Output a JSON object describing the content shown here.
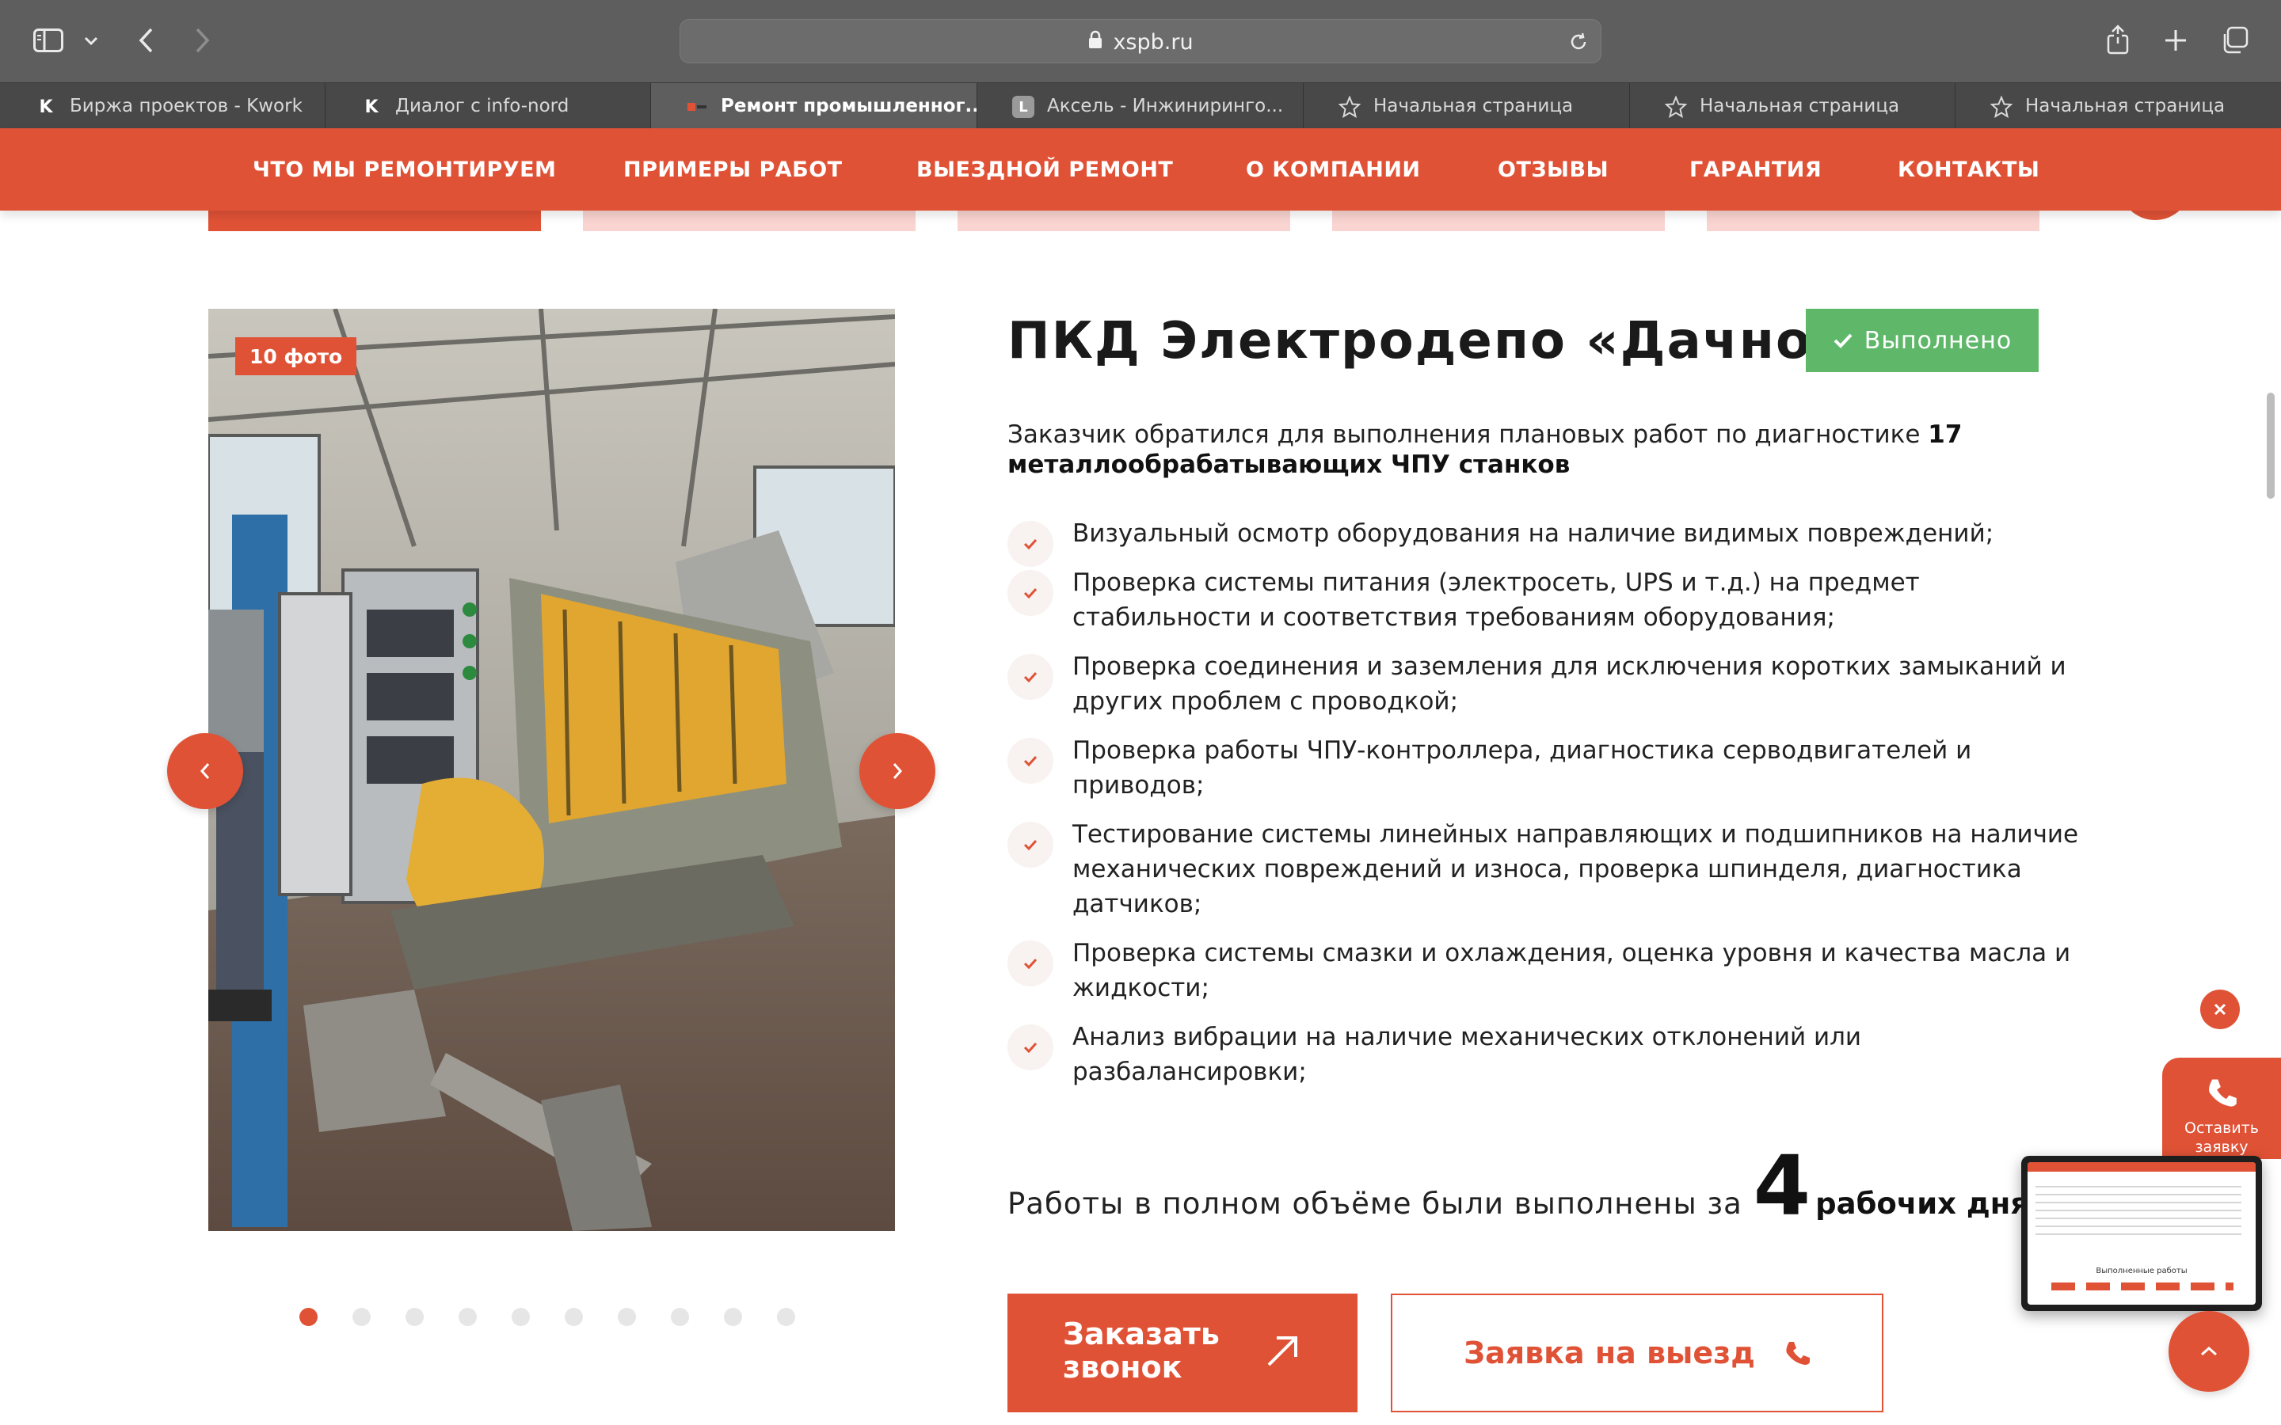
{
  "browser": {
    "url": "xspb.ru",
    "tabs": [
      {
        "label": "Биржа проектов - Kwork",
        "icon": "kwork-icon",
        "active": false
      },
      {
        "label": "Диалог с info-nord",
        "icon": "kwork-icon",
        "active": false
      },
      {
        "label": "Ремонт промышленног...",
        "icon": "site-icon",
        "active": true
      },
      {
        "label": "Аксель - Инжиниринго...",
        "icon": "letter-l-icon",
        "active": false
      },
      {
        "label": "Начальная страница",
        "icon": "star-icon",
        "active": false
      },
      {
        "label": "Начальная страница",
        "icon": "star-icon",
        "active": false
      },
      {
        "label": "Начальная страница",
        "icon": "star-icon",
        "active": false
      }
    ]
  },
  "nav": {
    "items": [
      "ЧТО МЫ РЕМОНТИРУЕМ",
      "ПРИМЕРЫ РАБОТ",
      "ВЫЕЗДНОЙ РЕМОНТ",
      "О КОМПАНИИ",
      "ОТЗЫВЫ",
      "ГАРАНТИЯ",
      "КОНТАКТЫ"
    ]
  },
  "gallery": {
    "badge": "10 фото",
    "total": 10,
    "active_index": 0
  },
  "project": {
    "title": "ПКД Электродепо «Дачное»",
    "status": "Выполнено",
    "intro_plain": "Заказчик обратился для выполнения плановых работ по диагностике ",
    "intro_bold": "17 металлообрабатывающих ЧПУ станков",
    "checklist": [
      "Визуальный осмотр оборудования на наличие видимых повреждений;",
      "Проверка системы питания (электросеть, UPS и т.д.) на предмет стабильности и соответствия требованиям оборудования;",
      "Проверка соединения и заземления для исключения коротких замыканий и других проблем с проводкой;",
      "Проверка работы ЧПУ-контроллера, диагностика серводвигателей и приводов;",
      "Тестирование системы линейных направляющих и подшипников на наличие механических повреждений и износа, проверка шпинделя, диагностика датчиков;",
      "Проверка системы смазки и охлаждения, оценка уровня и качества масла и жидкости;",
      "Анализ вибрации на наличие механических отклонений или разбалансировки;"
    ],
    "result_pre": "Работы в полном объёме были выполнены за",
    "result_num": "4",
    "result_post": "рабочих дня"
  },
  "buttons": {
    "call": "Заказать звонок",
    "visit": "Заявка на выезд"
  },
  "widget": {
    "lead_label": "Оставить заявку",
    "mini_caption": "Выполненные работы"
  },
  "colors": {
    "accent": "#e05236",
    "success": "#5fb86a",
    "chrome": "#5e5e5e"
  }
}
